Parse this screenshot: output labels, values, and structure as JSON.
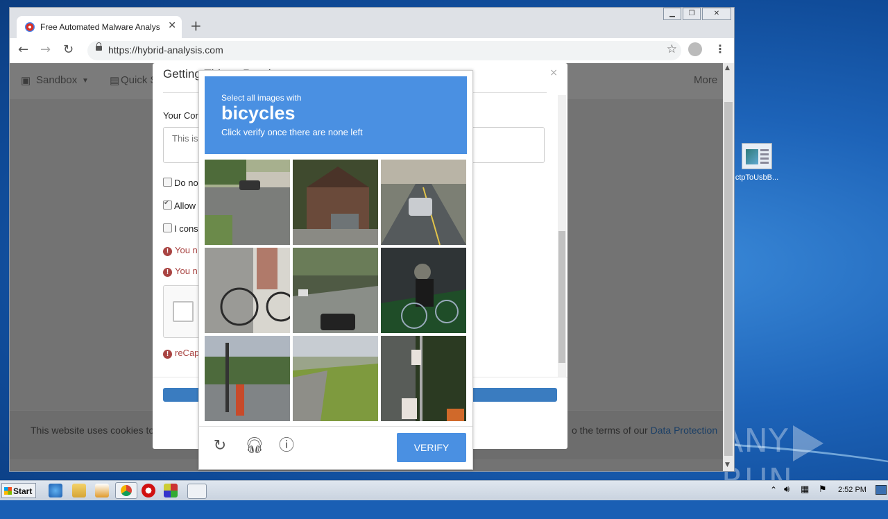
{
  "browser": {
    "tab_title": "Free Automated Malware Analysis S",
    "url": "https://hybrid-analysis.com",
    "window_controls": [
      "minimize",
      "maximize",
      "close"
    ]
  },
  "site": {
    "nav_sandbox": "Sandbox",
    "nav_quick": "Quick S",
    "nav_more": "More"
  },
  "modal": {
    "title": "Getting Things Read",
    "comment_label": "Your Cor",
    "comment_placeholder": "This is",
    "checkbox1": "Do no",
    "checkbox2": "Allow",
    "checkbox3": "I cons",
    "error1": "You n",
    "error2": "You n",
    "error3": "reCap"
  },
  "captcha": {
    "instruction_small": "Select all images with",
    "target_word": "bicycles",
    "instruction_hint": "Click verify once there are none left",
    "verify_label": "VERIFY",
    "icons": [
      "reload-icon",
      "audio-icon",
      "info-icon"
    ]
  },
  "cookie_bar": {
    "text_left": "This website uses cookies to",
    "text_right": "o the terms of our ",
    "link": "Data Protection"
  },
  "desktop": {
    "icon_label": "ctpToUsbB...",
    "watermark": "ANY RUN"
  },
  "taskbar": {
    "start_label": "Start",
    "clock": "2:52 PM"
  },
  "colors": {
    "captcha_blue": "#4a90e2",
    "error_red": "#a94442",
    "link_blue": "#1b3f66"
  }
}
